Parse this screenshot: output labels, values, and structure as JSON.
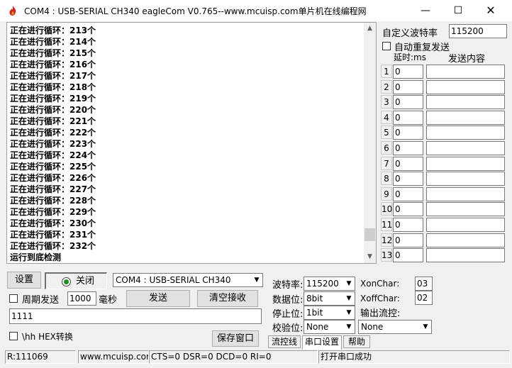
{
  "window": {
    "title": "COM4 : USB-SERIAL CH340   eagleCom V0.765--www.mcuisp.com单片机在线编程网",
    "min_glyph": "—",
    "max_glyph": "☐",
    "close_glyph": "✕",
    "icon": "flame-app-icon"
  },
  "receive": {
    "lines": [
      "正在进行循环：213个",
      "正在进行循环：214个",
      "正在进行循环：215个",
      "正在进行循环：216个",
      "正在进行循环：217个",
      "正在进行循环：218个",
      "正在进行循环：219个",
      "正在进行循环：220个",
      "正在进行循环：221个",
      "正在进行循环：222个",
      "正在进行循环：223个",
      "正在进行循环：224个",
      "正在进行循环：225个",
      "正在进行循环：226个",
      "正在进行循环：227个",
      "正在进行循环：228个",
      "正在进行循环：229个",
      "正在进行循环：230个",
      "正在进行循环：231个",
      "正在进行循环：232个",
      "运行到底检测"
    ],
    "scroll_up": "▲",
    "scroll_down": "▼",
    "scroll_position": 0.95
  },
  "multi_send": {
    "baud_label": "自定义波特率",
    "baud_value": "115200",
    "auto_repeat_label": "自动重复发送",
    "header_delay": "延时:ms",
    "header_content": "发送内容",
    "rows": [
      {
        "num": "1",
        "delay": "0",
        "content": ""
      },
      {
        "num": "2",
        "delay": "0",
        "content": ""
      },
      {
        "num": "3",
        "delay": "0",
        "content": ""
      },
      {
        "num": "4",
        "delay": "0",
        "content": ""
      },
      {
        "num": "5",
        "delay": "0",
        "content": ""
      },
      {
        "num": "6",
        "delay": "0",
        "content": ""
      },
      {
        "num": "7",
        "delay": "0",
        "content": ""
      },
      {
        "num": "8",
        "delay": "0",
        "content": ""
      },
      {
        "num": "9",
        "delay": "0",
        "content": ""
      },
      {
        "num": "10",
        "delay": "0",
        "content": ""
      },
      {
        "num": "11",
        "delay": "0",
        "content": ""
      },
      {
        "num": "12",
        "delay": "0",
        "content": ""
      },
      {
        "num": "13",
        "delay": "0",
        "content": ""
      }
    ]
  },
  "controls": {
    "settings_button": "设置",
    "close_port_button": "关闭",
    "port_led_color": "#1a8f1a",
    "port_select": "COM4 : USB-SERIAL CH340",
    "periodic_send_label": "周期发送",
    "period_value": "1000",
    "period_unit": "毫秒",
    "send_button": "发送",
    "clear_receive_button": "清空接收",
    "send_text": "1111",
    "hex_convert_label": "\\hh HEX转换",
    "save_window_button": "保存窗口"
  },
  "serial_settings": {
    "baud_label": "波特率:",
    "baud_value": "115200",
    "data_bits_label": "数据位:",
    "data_bits_value": "8bit",
    "stop_bits_label": "停止位:",
    "stop_bits_value": "1bit",
    "parity_label": "校验位:",
    "parity_value": "None",
    "xon_label": "XonChar:",
    "xon_value": "03",
    "xoff_label": "XoffChar:",
    "xoff_value": "02",
    "flow_label": "输出流控:",
    "flow_value": "None",
    "tabs": [
      "流控线",
      "串口设置",
      "帮助"
    ]
  },
  "status": {
    "received": "R:111069",
    "website": "www.mcuisp.com",
    "lines": "CTS=0 DSR=0 DCD=0 RI=0",
    "message": "打开串口成功"
  }
}
